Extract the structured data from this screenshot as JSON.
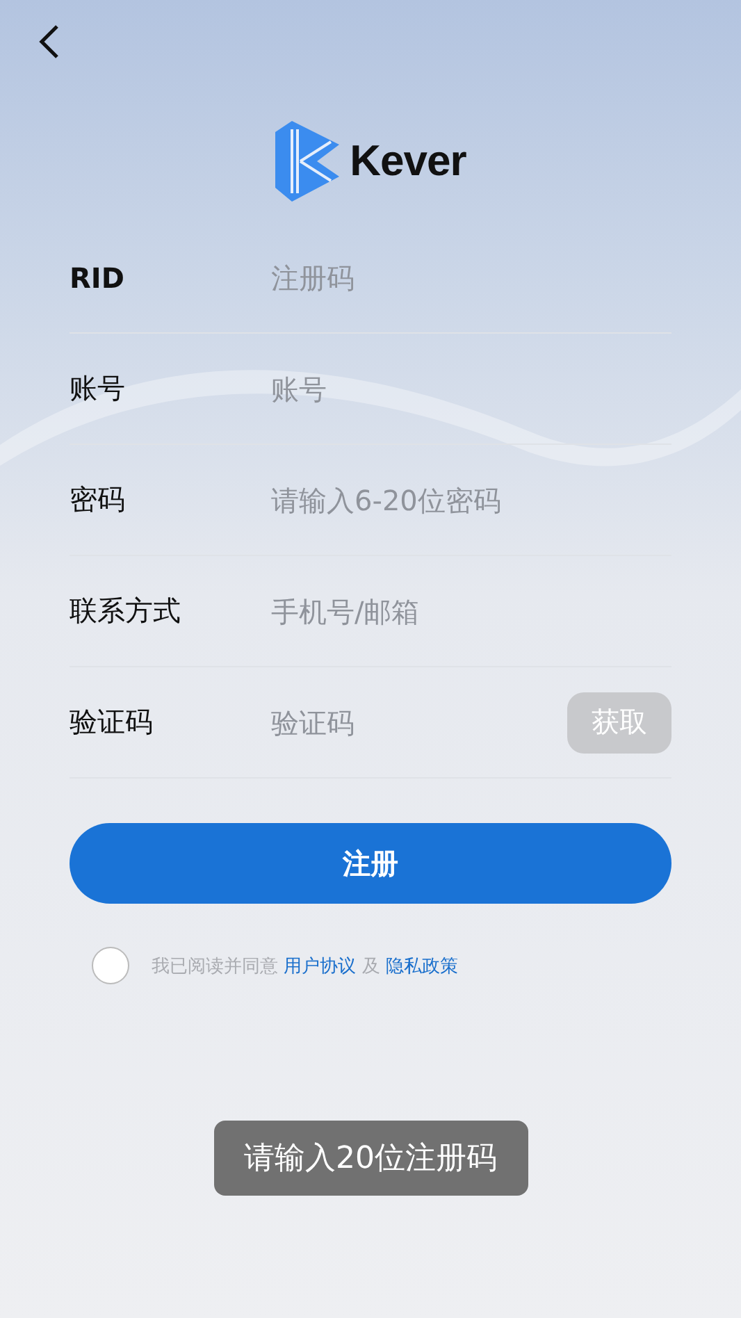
{
  "logo": {
    "wordmark": "Kever"
  },
  "fields": [
    {
      "kind": "text",
      "label": "RID",
      "placeholder": "注册码"
    },
    {
      "kind": "text",
      "label": "账号",
      "placeholder": "账号"
    },
    {
      "kind": "password",
      "label": "密码",
      "placeholder": "请输入6-20位密码"
    },
    {
      "kind": "text",
      "label": "联系方式",
      "placeholder": "手机号/邮箱"
    },
    {
      "kind": "code",
      "label": "验证码",
      "placeholder": "验证码",
      "button": {
        "label": "获取",
        "disabled": true
      }
    }
  ],
  "submit": {
    "label": "注册"
  },
  "agreement": {
    "checked": false,
    "prefix": "我已阅读并同意",
    "link_1": "用户协议",
    "conjunction": "及",
    "link_2": "隐私政策"
  },
  "toast": {
    "message": "请输入20位注册码"
  }
}
